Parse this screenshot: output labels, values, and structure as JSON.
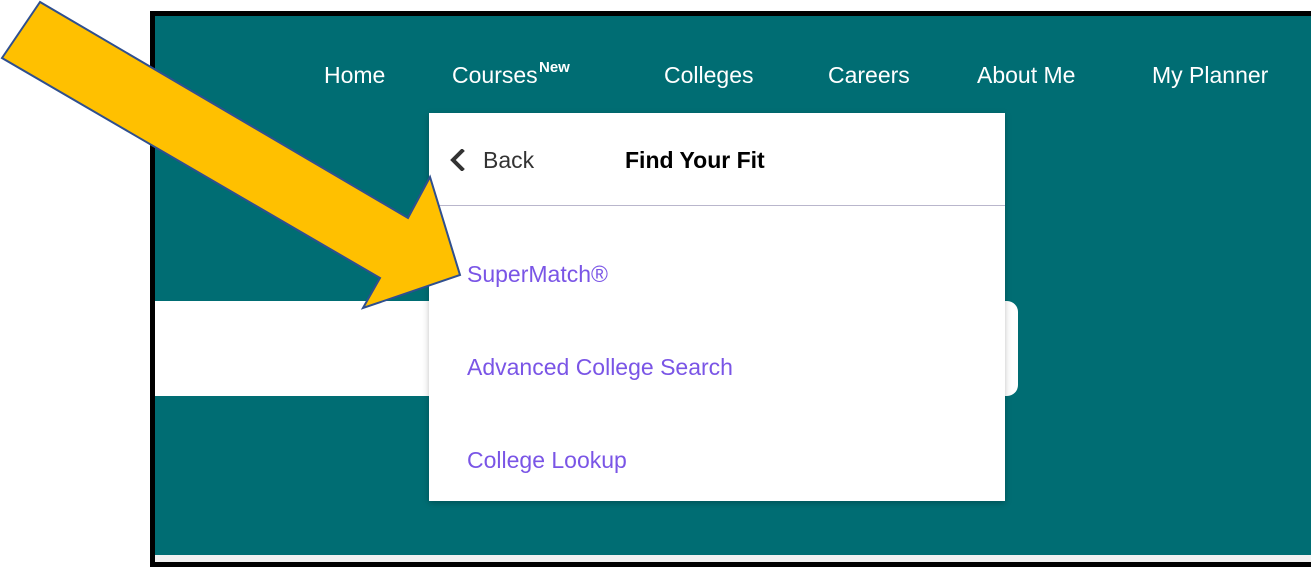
{
  "nav": {
    "items": [
      {
        "label": "Home"
      },
      {
        "label": "Courses",
        "badge": "New"
      },
      {
        "label": "Colleges"
      },
      {
        "label": "Careers"
      },
      {
        "label": "About Me"
      },
      {
        "label": "My Planner"
      }
    ]
  },
  "dropdown": {
    "back_label": "Back",
    "title": "Find Your Fit",
    "links": [
      {
        "label": "SuperMatch®"
      },
      {
        "label": "Advanced College Search"
      },
      {
        "label": "College Lookup"
      }
    ]
  },
  "colors": {
    "header_bg": "#006d73",
    "link": "#7a55e6",
    "arrow_fill": "#ffc000",
    "arrow_stroke": "#2f4f8f"
  },
  "icons": {
    "back": "chevron-left-icon",
    "annotation": "arrow-pointer"
  }
}
